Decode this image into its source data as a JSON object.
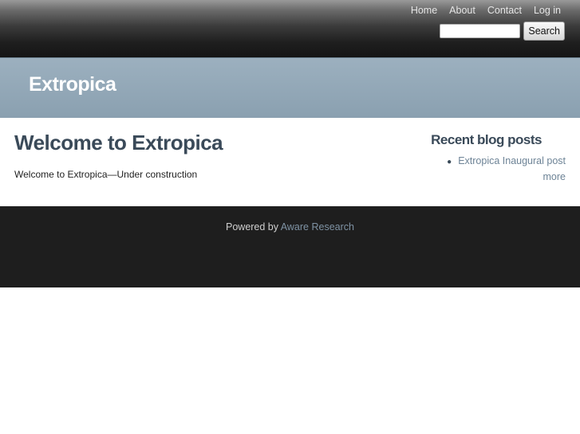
{
  "nav": {
    "items": [
      {
        "label": "Home"
      },
      {
        "label": "About"
      },
      {
        "label": "Contact"
      },
      {
        "label": "Log in"
      }
    ]
  },
  "search": {
    "value": "",
    "button_label": "Search"
  },
  "banner": {
    "site_name": "Extropica"
  },
  "main": {
    "title": "Welcome to Extropica",
    "body": "Welcome to Extropica—Under construction"
  },
  "sidebar": {
    "heading": "Recent blog posts",
    "posts": [
      {
        "label": "Extropica Inaugural post"
      }
    ],
    "more_label": "more"
  },
  "footer": {
    "prefix": "Powered by ",
    "link_label": "Aware Research"
  }
}
